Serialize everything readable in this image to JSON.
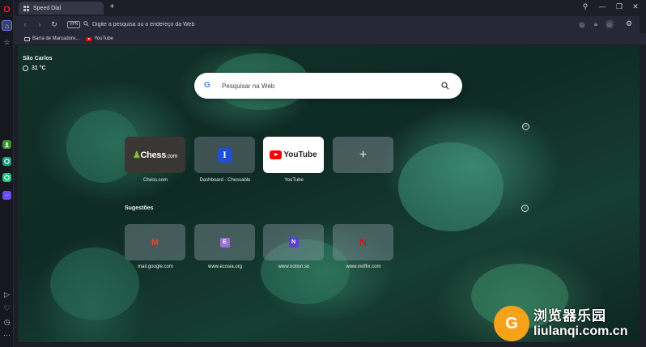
{
  "tab": {
    "title": "Speed Dial",
    "new_tab": "+"
  },
  "window": {
    "search": "⚲",
    "minimize": "—",
    "restore": "❐",
    "close": "✕"
  },
  "addressbar": {
    "vpn": "VPN",
    "placeholder": "Digite a pesquisa ou o endereço da Web"
  },
  "bookmarks": [
    {
      "label": "Barra de Marcadore..."
    },
    {
      "label": "YouTube"
    }
  ],
  "weather": {
    "city": "São Carlos",
    "temp": "31 °C"
  },
  "search": {
    "placeholder": "Pesquisar na Web",
    "logo": "G"
  },
  "speed_dial": [
    {
      "label": "Chess.com",
      "logo_main": "Chess",
      "logo_suffix": ".com"
    },
    {
      "label": "Dashboard - Chessable",
      "logo": "I"
    },
    {
      "label": "YouTube",
      "logo": "YouTube"
    },
    {
      "label": "",
      "logo": "+"
    }
  ],
  "suggestions_title": "Sugestões",
  "suggestions": [
    {
      "label": "mail.google.com",
      "logo": "M",
      "color": "#ea4335"
    },
    {
      "label": "www.ecosia.org",
      "logo": "E",
      "color": "#9b6fd6"
    },
    {
      "label": "www.notion.so",
      "logo": "N",
      "color": "#5b3fd6"
    },
    {
      "label": "www.netflix.com",
      "logo": "N",
      "color": "#e50914"
    }
  ],
  "watermark": {
    "cn": "浏览器乐园",
    "en": "liulanqi.com.cn",
    "logo": "G"
  }
}
